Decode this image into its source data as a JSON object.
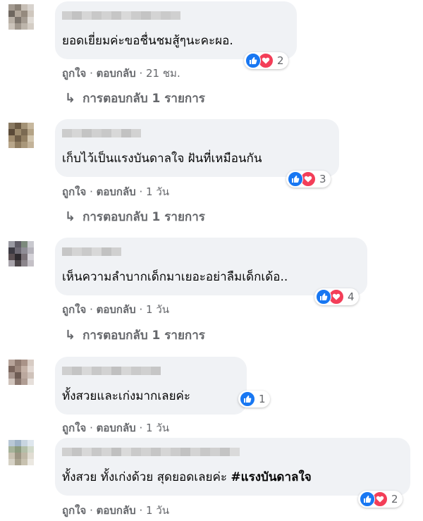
{
  "comments": [
    {
      "text": "ยอดเยี่ยมค่ะขอชื่นชมสู้ๆนะคะผอ.",
      "hashtag": "",
      "reaction_count": "2",
      "has_love": true,
      "like_label": "ถูกใจ",
      "reply_label": "ตอบกลับ",
      "time": "21 ชม.",
      "replies_label": "การตอบกลับ 1 รายการ"
    },
    {
      "text": "เก็บไว้เป็นแรงบันดาลใจ ฝันที่เหมือนกัน",
      "hashtag": "",
      "reaction_count": "3",
      "has_love": true,
      "like_label": "ถูกใจ",
      "reply_label": "ตอบกลับ",
      "time": "1 วัน",
      "replies_label": "การตอบกลับ 1 รายการ"
    },
    {
      "text": "เห็นความลำบากเด็กมาเยอะอย่าลืมเด็กเด้อ..",
      "hashtag": "",
      "reaction_count": "4",
      "has_love": true,
      "like_label": "ถูกใจ",
      "reply_label": "ตอบกลับ",
      "time": "1 วัน",
      "replies_label": "การตอบกลับ 1 รายการ"
    },
    {
      "text": "ทั้งสวยและเก่งมากเลยค่ะ",
      "hashtag": "",
      "reaction_count": "1",
      "has_love": false,
      "like_label": "ถูกใจ",
      "reply_label": "ตอบกลับ",
      "time": "1 วัน",
      "replies_label": ""
    },
    {
      "text": "ทั้งสวย ทั้งเก่งด้วย สุดยอดเลยค่ะ ",
      "hashtag": "#แรงบันดาลใจ",
      "reaction_count": "2",
      "has_love": true,
      "like_label": "ถูกใจ",
      "reply_label": "ตอบกลับ",
      "time": "1 วัน",
      "replies_label": ""
    }
  ],
  "colors": {
    "like": "#1877f2",
    "love": "#f33e58",
    "bubble": "#f0f2f5",
    "meta": "#65676b"
  },
  "icons": {
    "like": "thumbs-up-icon",
    "love": "heart-icon",
    "reply_arrow": "reply-arrow-icon"
  }
}
